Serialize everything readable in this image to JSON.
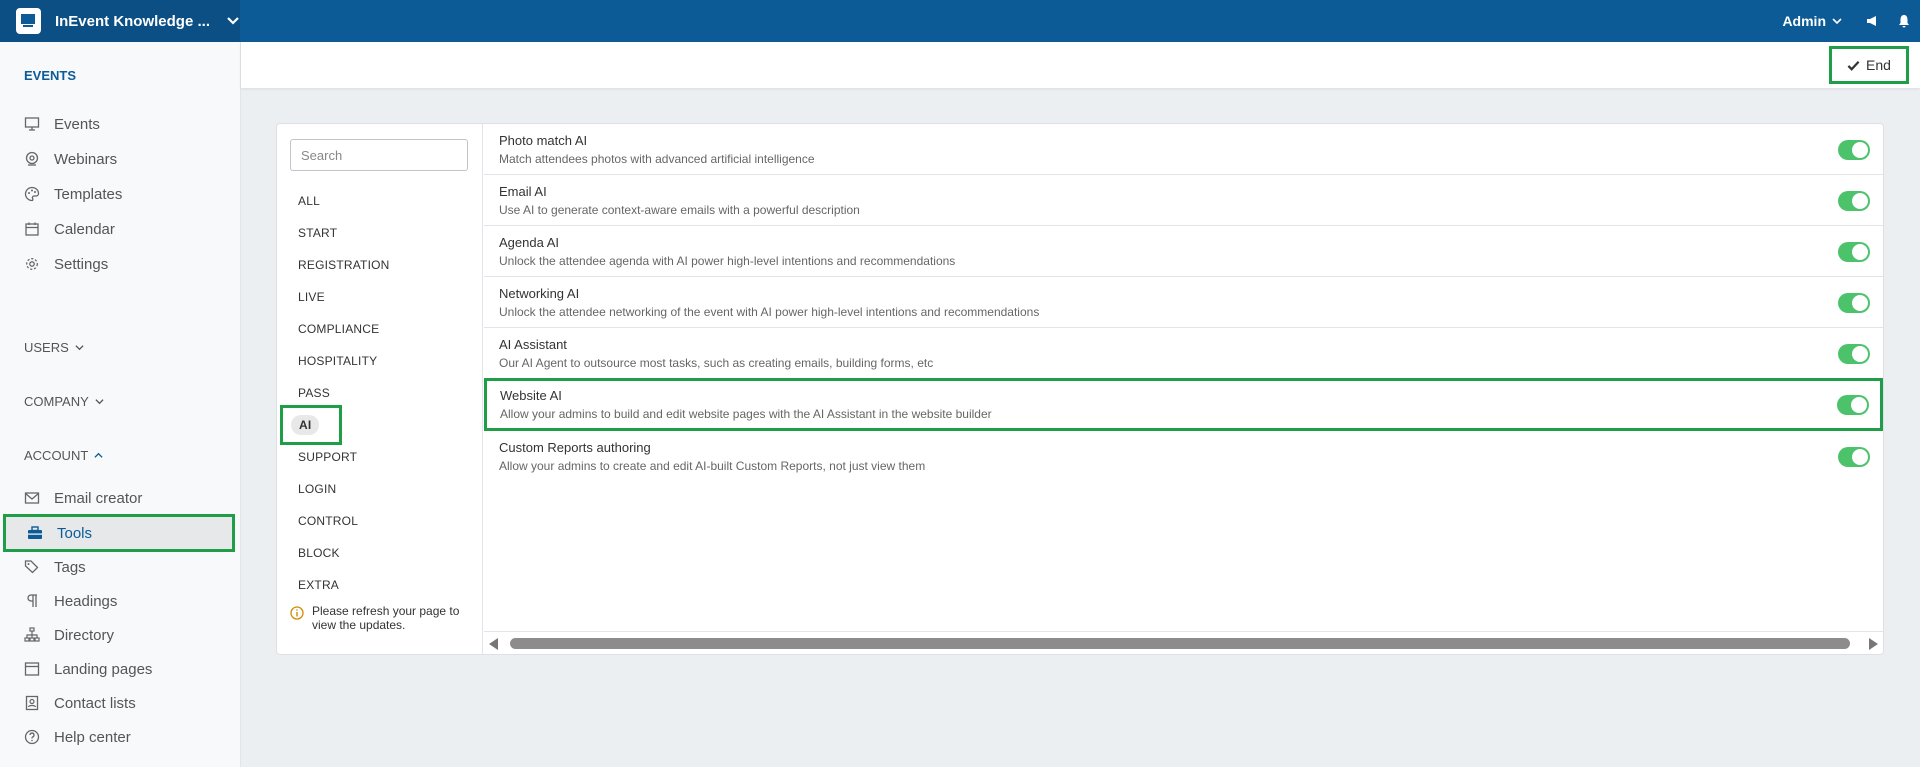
{
  "topbar": {
    "app_title": "InEvent Knowledge ...",
    "user_label": "Admin"
  },
  "sidebar": {
    "events_header": "EVENTS",
    "events_items": [
      {
        "label": "Events",
        "icon": "presentation-icon"
      },
      {
        "label": "Webinars",
        "icon": "webinar-icon"
      },
      {
        "label": "Templates",
        "icon": "palette-icon"
      },
      {
        "label": "Calendar",
        "icon": "calendar-icon"
      },
      {
        "label": "Settings",
        "icon": "gear-icon"
      }
    ],
    "users_header": "USERS",
    "company_header": "COMPANY",
    "account_header": "ACCOUNT",
    "account_items": [
      {
        "label": "Email creator",
        "icon": "envelope-icon"
      },
      {
        "label": "Tools",
        "icon": "toolbox-icon"
      },
      {
        "label": "Tags",
        "icon": "tags-icon"
      },
      {
        "label": "Headings",
        "icon": "pilcrow-icon"
      },
      {
        "label": "Directory",
        "icon": "sitemap-icon"
      },
      {
        "label": "Landing pages",
        "icon": "window-icon"
      },
      {
        "label": "Contact lists",
        "icon": "contact-book-icon"
      },
      {
        "label": "Help center",
        "icon": "question-circle-icon"
      }
    ]
  },
  "actionbar": {
    "end_label": "End"
  },
  "tools": {
    "search_placeholder": "Search",
    "categories": [
      "ALL",
      "START",
      "REGISTRATION",
      "LIVE",
      "COMPLIANCE",
      "HOSPITALITY",
      "PASS",
      "AI",
      "SUPPORT",
      "LOGIN",
      "CONTROL",
      "BLOCK",
      "EXTRA"
    ],
    "selected_category": "AI",
    "refresh_note": "Please refresh your page to view the updates.",
    "features": [
      {
        "title": "Photo match AI",
        "description": "Match attendees photos with advanced artificial intelligence",
        "enabled": true
      },
      {
        "title": "Email AI",
        "description": "Use AI to generate context-aware emails with a powerful description",
        "enabled": true
      },
      {
        "title": "Agenda AI",
        "description": "Unlock the attendee agenda with AI power high-level intentions and recommendations",
        "enabled": true
      },
      {
        "title": "Networking AI",
        "description": "Unlock the attendee networking of the event with AI power high-level intentions and recommendations",
        "enabled": true
      },
      {
        "title": "AI Assistant",
        "description": "Our AI Agent to outsource most tasks, such as creating emails, building forms, etc",
        "enabled": true
      },
      {
        "title": "Website AI",
        "description": "Allow your admins to build and edit website pages with the AI Assistant in the website builder",
        "enabled": true
      },
      {
        "title": "Custom Reports authoring",
        "description": "Allow your admins to create and edit AI-built Custom Reports, not just view them",
        "enabled": true
      }
    ]
  },
  "colors": {
    "topbar": "#0c5b96",
    "highlight": "#1f9e47",
    "toggle_on": "#4cc36b"
  }
}
